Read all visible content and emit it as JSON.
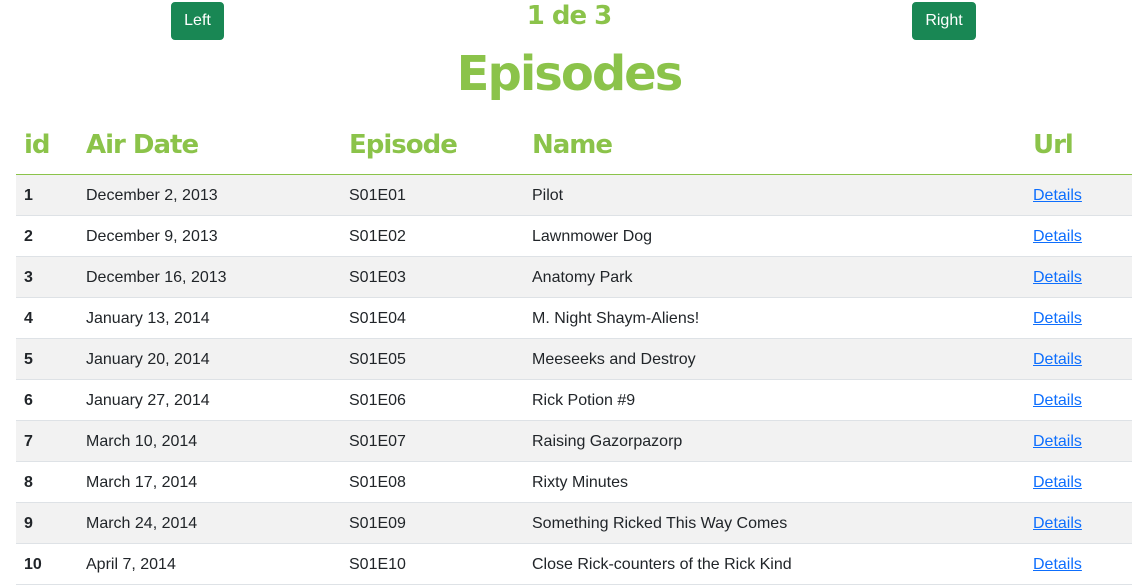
{
  "colors": {
    "accent": "#8bc34a",
    "button": "#198754",
    "link": "#0d6efd"
  },
  "nav": {
    "left_label": "Left",
    "right_label": "Right",
    "pager": "1 de 3"
  },
  "title": "Episodes",
  "table": {
    "headers": {
      "id": "id",
      "air_date": "Air Date",
      "episode": "Episode",
      "name": "Name",
      "url": "Url"
    },
    "rows": [
      {
        "id": "1",
        "air_date": "December 2, 2013",
        "episode": "S01E01",
        "name": "Pilot",
        "url": "Details"
      },
      {
        "id": "2",
        "air_date": "December 9, 2013",
        "episode": "S01E02",
        "name": "Lawnmower Dog",
        "url": "Details"
      },
      {
        "id": "3",
        "air_date": "December 16, 2013",
        "episode": "S01E03",
        "name": "Anatomy Park",
        "url": "Details"
      },
      {
        "id": "4",
        "air_date": "January 13, 2014",
        "episode": "S01E04",
        "name": "M. Night Shaym-Aliens!",
        "url": "Details"
      },
      {
        "id": "5",
        "air_date": "January 20, 2014",
        "episode": "S01E05",
        "name": "Meeseeks and Destroy",
        "url": "Details"
      },
      {
        "id": "6",
        "air_date": "January 27, 2014",
        "episode": "S01E06",
        "name": "Rick Potion #9",
        "url": "Details"
      },
      {
        "id": "7",
        "air_date": "March 10, 2014",
        "episode": "S01E07",
        "name": "Raising Gazorpazorp",
        "url": "Details"
      },
      {
        "id": "8",
        "air_date": "March 17, 2014",
        "episode": "S01E08",
        "name": "Rixty Minutes",
        "url": "Details"
      },
      {
        "id": "9",
        "air_date": "March 24, 2014",
        "episode": "S01E09",
        "name": "Something Ricked This Way Comes",
        "url": "Details"
      },
      {
        "id": "10",
        "air_date": "April 7, 2014",
        "episode": "S01E10",
        "name": "Close Rick-counters of the Rick Kind",
        "url": "Details"
      }
    ]
  }
}
